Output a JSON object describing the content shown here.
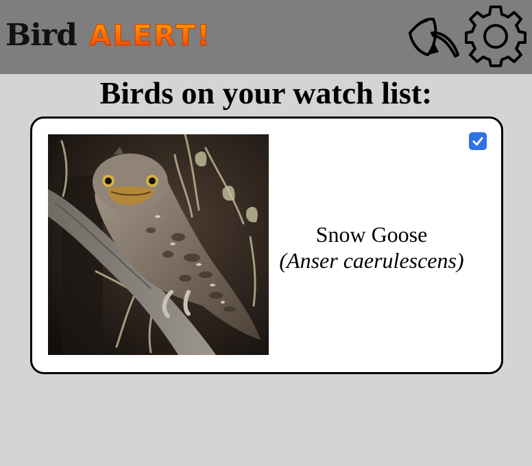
{
  "header": {
    "logo_word1": "Bird",
    "logo_word2": "ALERT!",
    "background": "#7e7e7e",
    "actions": [
      {
        "name": "feather-icon"
      },
      {
        "name": "gear-icon"
      }
    ]
  },
  "main": {
    "title": "Birds on your watch list:",
    "background": "#d4d4d4"
  },
  "watchlist": [
    {
      "common_name": "Snow Goose",
      "scientific_name": "(Anser caerulescens)",
      "checked": true,
      "photo_icon": "bird-photo"
    }
  ],
  "colors": {
    "checkbox": "#2f72e6",
    "logo_alert_top": "#ffae00",
    "logo_alert_bottom": "#e02400"
  }
}
